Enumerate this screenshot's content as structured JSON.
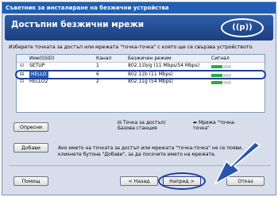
{
  "window": {
    "title": "Съветник за инсталиране на безжични устройства"
  },
  "banner": {
    "title": "Достъпни безжични мрежи",
    "logo_text": "((p))"
  },
  "instructions": "Изберете точката за достъп или мрежата \"точка-точка\" с която ще се свързва устройството.",
  "table": {
    "headers": [
      "Име(SSID)",
      "Канал",
      "Безжичен режим",
      "Сигнал"
    ],
    "rows": [
      {
        "name": "SETUP",
        "channel": "1",
        "mode": "802.11b/g (11 Mbps/54 Mbps)",
        "signal_level": 0.6,
        "signal_color": "#2eaa45"
      },
      {
        "name": "HELLO",
        "channel": "6",
        "mode": "802.11b (11 Mbps)",
        "signal_level": 0.6,
        "signal_color": "#2eaa45",
        "selected": true
      },
      {
        "name": "HELLO2",
        "channel": "2",
        "mode": "802.11g (54 Mbps)",
        "signal_level": 0.6,
        "signal_color": "#2eaa45"
      }
    ]
  },
  "buttons": {
    "refresh": "Опресни",
    "add": "Добави",
    "help": "Помощ",
    "back": "< Назад",
    "next": "Напред >",
    "cancel": "Отказ"
  },
  "legend": {
    "ap": "Точка за достъп/Базова станция",
    "adhoc": "Мрежа \"точка-точка\""
  },
  "note": "Ако името на точката за достъп или мрежата \"точка-точка\" не се появи, кликнете бутона \"Добави\", за да посочите името на мрежата.",
  "colors": {
    "accent": "#1c3f9a",
    "banner": "#2d5ea9",
    "arrow": "#2a55a8"
  }
}
